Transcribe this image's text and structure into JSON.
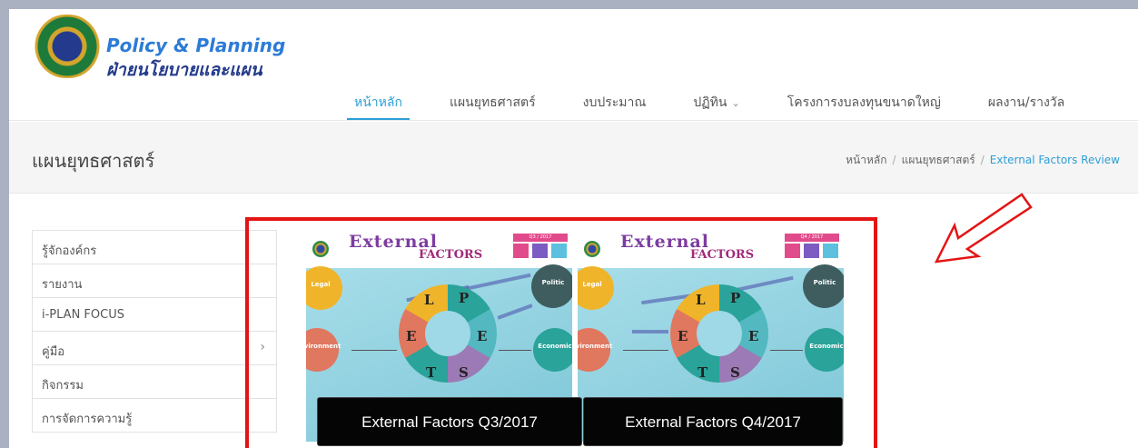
{
  "logo": {
    "title_en": "Policy & Planning",
    "title_th": "ฝ่ายนโยบายและแผน",
    "seal_icon": "university-seal-icon"
  },
  "nav": {
    "items": [
      {
        "label": "หน้าหลัก",
        "active": true
      },
      {
        "label": "แผนยุทธศาสตร์",
        "active": false
      },
      {
        "label": "งบประมาณ",
        "active": false
      },
      {
        "label": "ปฏิทิน",
        "active": false,
        "has_dropdown": true
      },
      {
        "label": "โครงการงบลงทุนขนาดใหญ่",
        "active": false
      },
      {
        "label": "ผลงาน/รางวัล",
        "active": false
      }
    ],
    "accent_color": "#2c9fd6"
  },
  "page": {
    "title": "แผนยุทธศาสตร์",
    "breadcrumb": [
      "หน้าหลัก",
      "แผนยุทธศาสตร์",
      "External Factors Review"
    ]
  },
  "sidebar": {
    "items": [
      {
        "label": "รู้จักองค์กร"
      },
      {
        "label": "รายงาน"
      },
      {
        "label": "i-PLAN FOCUS"
      },
      {
        "label": "คู่มือ",
        "has_submenu": true
      },
      {
        "label": "กิจกรรม"
      },
      {
        "label": "การจัดการความรู้"
      }
    ]
  },
  "cards": [
    {
      "heading_1": "External",
      "heading_2": "FACTORS",
      "quarter_badge": "Q3 / 2017",
      "letters": [
        "L",
        "P",
        "E",
        "E",
        "T",
        "S"
      ],
      "bubbles": [
        "Legal",
        "Politic",
        "Environment",
        "Economic"
      ],
      "caption": "External Factors Q3/2017"
    },
    {
      "heading_1": "External",
      "heading_2": "FACTORS",
      "quarter_badge": "Q4 / 2017",
      "letters": [
        "L",
        "P",
        "E",
        "E",
        "T",
        "S"
      ],
      "bubbles": [
        "Legal",
        "Politic",
        "Environment",
        "Economic"
      ],
      "caption": "External Factors Q4/2017"
    }
  ],
  "annotation": {
    "highlight_color": "#e41414",
    "arrow_icon": "outline-arrow-pointing-down-left-icon"
  }
}
